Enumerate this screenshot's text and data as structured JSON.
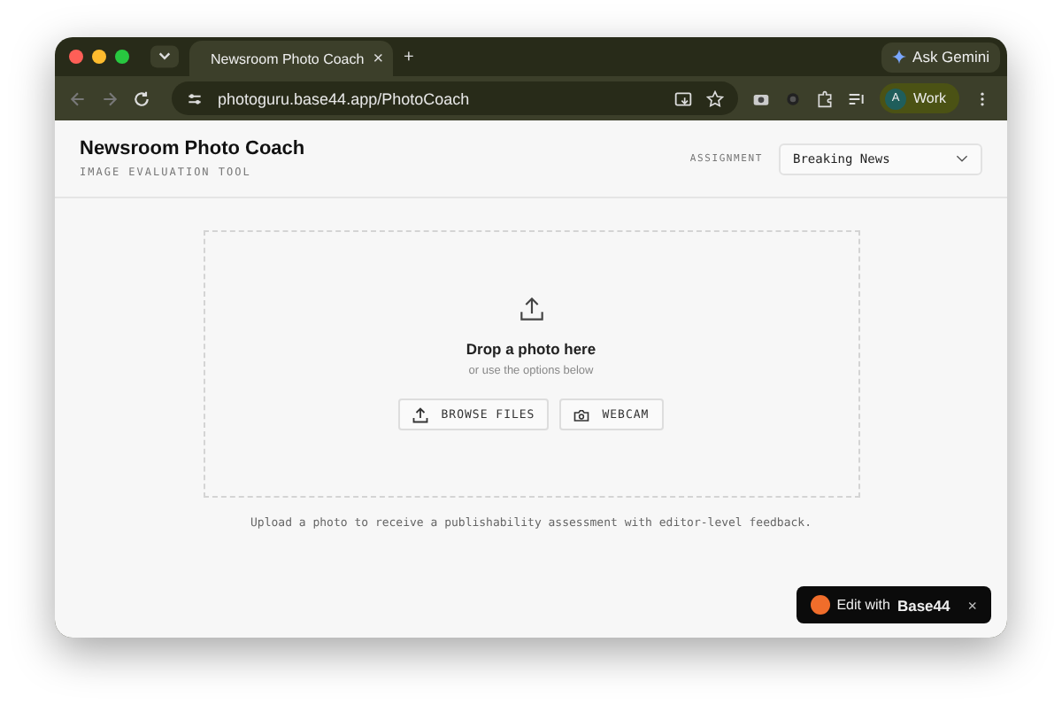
{
  "browser": {
    "tab_title": "Newsroom Photo Coach",
    "new_tab": "+",
    "close_tab": "×",
    "ask_button": "Ask Gemini",
    "url": "photoguru.base44.app/PhotoCoach",
    "profile_initial": "A",
    "profile_name": "Work"
  },
  "header": {
    "title": "Newsroom Photo Coach",
    "subtitle": "IMAGE EVALUATION TOOL",
    "assignment_label": "ASSIGNMENT",
    "assignment_value": "Breaking News"
  },
  "dropzone": {
    "heading": "Drop a photo here",
    "hint": "or use the options below",
    "buttons": [
      {
        "kind": "browse",
        "label": "BROWSE FILES"
      },
      {
        "kind": "webcam",
        "label": "WEBCAM"
      }
    ]
  },
  "caption": "Upload a photo to receive a publishability assessment with editor-level feedback.",
  "badge": {
    "prefix": "Edit with",
    "brand": "Base44",
    "close": "×"
  }
}
